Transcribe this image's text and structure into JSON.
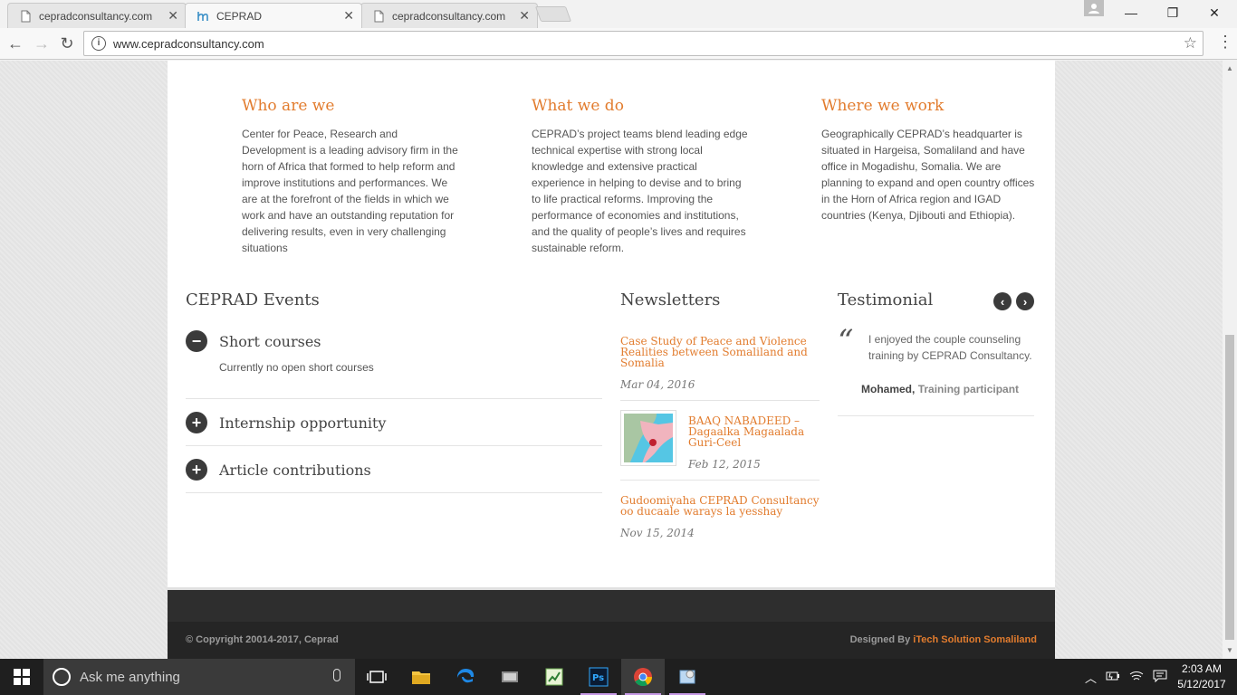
{
  "browser": {
    "tabs": [
      {
        "title": "cepradconsultancy.com",
        "active": false
      },
      {
        "title": "CEPRAD",
        "active": true
      },
      {
        "title": "cepradconsultancy.com",
        "active": false
      }
    ],
    "url": "www.cepradconsultancy.com"
  },
  "about": {
    "who": {
      "title": "Who are we",
      "text": "Center for Peace, Research and Development is a leading advisory firm in the horn of Africa that formed to help reform and improve institutions and performances. We are at the forefront of the fields in which we work and have an outstanding reputation for delivering results, even in very challenging situations"
    },
    "what": {
      "title": "What we do",
      "text": "CEPRAD’s project teams blend leading edge technical expertise with strong local knowledge and extensive practical experience in helping to devise and to bring to life practical reforms. Improving the performance of economies and institutions, and the quality of people’s lives and requires sustainable reform."
    },
    "where": {
      "title": "Where we work",
      "text": "Geographically CEPRAD’s headquarter is situated in Hargeisa, Somaliland and have office in Mogadishu, Somalia. We are planning to expand and open country offices in the Horn of Africa region and IGAD countries (Kenya, Djibouti and Ethiopia)."
    }
  },
  "events": {
    "title": "CEPRAD Events",
    "items": [
      {
        "label": "Short courses",
        "expanded": true,
        "body": "Currently no open short courses"
      },
      {
        "label": "Internship opportunity",
        "expanded": false
      },
      {
        "label": "Article contributions",
        "expanded": false
      }
    ]
  },
  "newsletters": {
    "title": "Newsletters",
    "items": [
      {
        "title": "Case Study of Peace and Violence Realities between Somaliland and Somalia",
        "date": "Mar 04, 2016"
      },
      {
        "title": "BAAQ NABADEED – Dagaalka Magaalada Guri-Ceel",
        "date": "Feb 12, 2015"
      },
      {
        "title": "Gudoomiyaha CEPRAD Consultancy oo ducaale warays la yesshay",
        "date": "Nov 15, 2014"
      }
    ]
  },
  "testimonial": {
    "title": "Testimonial",
    "quote": "I enjoyed the couple counseling training by CEPRAD Consultancy.",
    "author": "Mohamed",
    "role": "Training participant"
  },
  "footer": {
    "copyright": "© Copyright 20014-2017, Ceprad",
    "designed_by": "Designed By",
    "designer": "iTech Solution Somaliland"
  },
  "taskbar": {
    "search_placeholder": "Ask me anything",
    "time": "2:03 AM",
    "date": "5/12/2017"
  },
  "colors": {
    "accent": "#e27c2e",
    "dark": "#3b3b3b",
    "footer": "#252525"
  }
}
